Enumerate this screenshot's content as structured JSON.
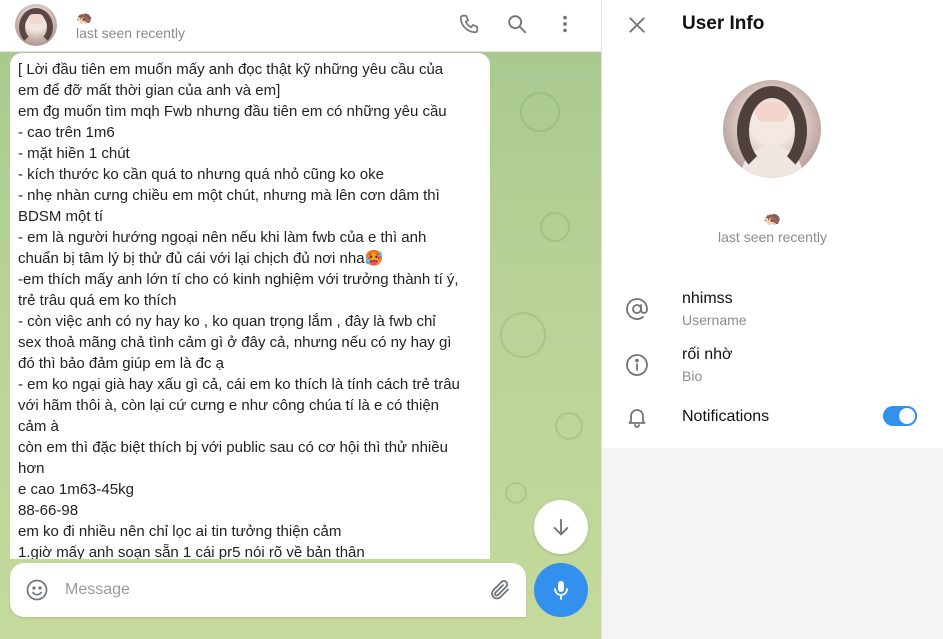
{
  "chat": {
    "name_emoji": "🦔",
    "status": "last seen recently",
    "message_lines": [
      "[ Lời đầu tiên em muốn mấy anh đọc thật kỹ những yêu cầu của",
      "em để đỡ mất thời gian của anh và em]",
      "em đg muốn tìm mqh Fwb nhưng đầu tiên em có những yêu cầu",
      "- cao trên 1m6",
      "- mặt hiền 1 chút",
      "- kích thước ko cần quá to nhưng quá nhỏ cũng ko oke",
      "- nhẹ nhàn cưng chiều em một chút, nhưng mà lên cơn dâm thì",
      "BDSM một tí",
      "- em là người hướng ngoại nên nếu khi làm fwb của e thì anh",
      "chuẩn bị tâm lý bị thử đủ cái với lại chịch đủ nơi nha🥵",
      "-em thích mấy anh lớn tí cho có kinh nghiệm với trưởng thành tí ý,",
      "trẻ trâu quá em ko thích",
      "- còn việc anh có ny hay ko , ko quan trọng lắm , đây là fwb chỉ",
      "sex thoả mãng chả tình cảm gì ở đây cả, nhưng nếu có ny hay gì",
      "đó thì bảo đảm giúp em là đc ạ",
      "- em ko ngại già hay xấu gì cả, cái em ko thích là tính cách trẻ trâu",
      "với hãm thôi à, còn lại cứ cưng e như công chúa tí là e có thiện",
      "cảm à",
      "còn em thì đặc biệt thích bj với public sau có cơ hội thì thử nhiều",
      "hơn",
      "e cao 1m63-45kg",
      "88-66-98",
      "em ko đi nhiều nên chỉ lọc ai tin tưởng thiện cảm",
      "1.giờ mấy anh soạn sẵn 1 cái pr5 nói rõ về bản thân"
    ],
    "composer_placeholder": "Message"
  },
  "info": {
    "title": "User Info",
    "name_emoji": "🦔",
    "status": "last seen recently",
    "username": "nhimss",
    "username_label": "Username",
    "bio": "rối nhờ",
    "bio_label": "Bio",
    "notifications_label": "Notifications",
    "notifications_enabled": true
  },
  "colors": {
    "accent": "#3390ec",
    "chat_bg": "#b8d297"
  },
  "icons": {
    "header": [
      "phone-icon",
      "search-icon",
      "more-vertical-icon"
    ],
    "composer": [
      "smile-icon",
      "paperclip-icon",
      "microphone-icon"
    ],
    "info": [
      "close-icon",
      "at-sign-icon",
      "info-icon",
      "bell-icon"
    ],
    "chat": [
      "arrow-down-icon"
    ]
  }
}
